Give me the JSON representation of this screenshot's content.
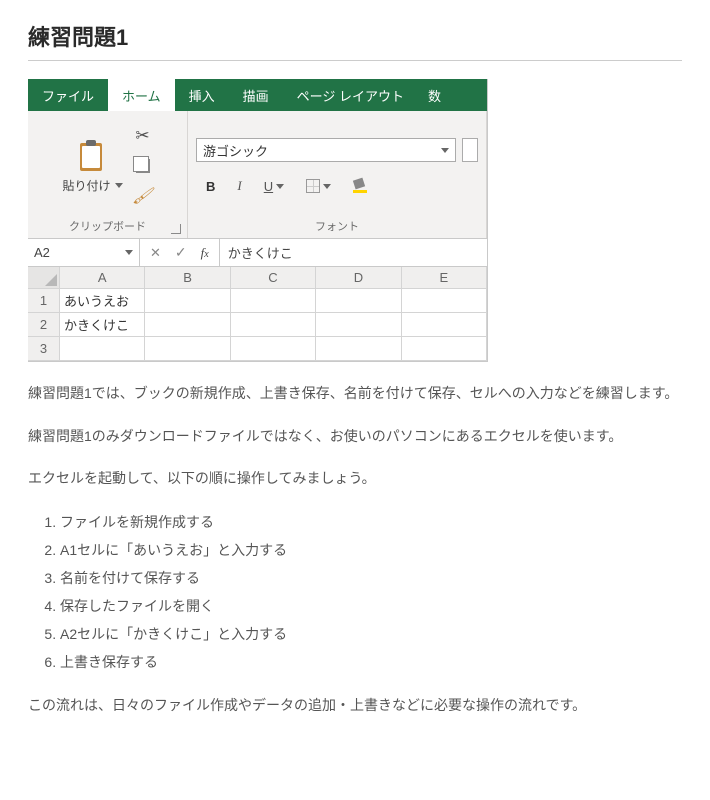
{
  "title": "練習問題1",
  "excel": {
    "tabs": [
      "ファイル",
      "ホーム",
      "挿入",
      "描画",
      "ページ レイアウト",
      "数"
    ],
    "active_tab_index": 1,
    "clipboard": {
      "paste_label": "貼り付け",
      "group_label": "クリップボード"
    },
    "font": {
      "name": "游ゴシック",
      "group_label": "フォント"
    },
    "namebox": "A2",
    "formula_value": "かきくけこ",
    "columns": [
      "A",
      "B",
      "C",
      "D",
      "E"
    ],
    "rows": [
      {
        "num": "1",
        "A": "あいうえお"
      },
      {
        "num": "2",
        "A": "かきくけこ"
      },
      {
        "num": "3",
        "A": ""
      }
    ]
  },
  "paragraphs": {
    "p1": "練習問題1では、ブックの新規作成、上書き保存、名前を付けて保存、セルへの入力などを練習します。",
    "p2": "練習問題1のみダウンロードファイルではなく、お使いのパソコンにあるエクセルを使います。",
    "p3": "エクセルを起動して、以下の順に操作してみましょう。",
    "p4": "この流れは、日々のファイル作成やデータの追加・上書きなどに必要な操作の流れです。"
  },
  "steps": [
    "ファイルを新規作成する",
    "A1セルに「あいうえお」と入力する",
    "名前を付けて保存する",
    "保存したファイルを開く",
    "A2セルに「かきくけこ」と入力する",
    "上書き保存する"
  ]
}
